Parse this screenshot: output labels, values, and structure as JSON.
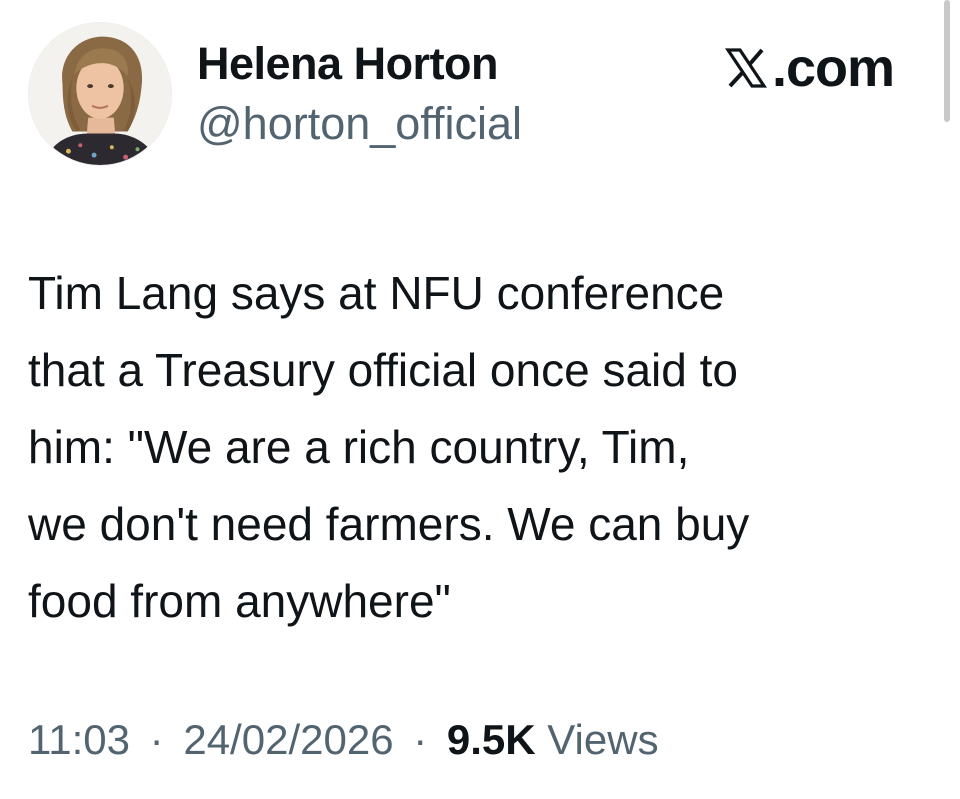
{
  "author": {
    "display_name": "Helena Horton",
    "handle": "@horton_official",
    "avatar_icon": "profile-photo"
  },
  "brand": {
    "icon": "x-logo-icon",
    "label": "𝕏.com",
    "text": ".com"
  },
  "tweet": {
    "text": "Tim Lang says at NFU conference\nthat a Treasury official once said to\nhim: \"We are a rich country, Tim,\nwe don't need farmers. We can buy\nfood from anywhere\""
  },
  "meta": {
    "time": "11:03",
    "separator": "·",
    "date": "24/02/2026",
    "views_count": "9.5K",
    "views_label": "Views"
  },
  "colors": {
    "primary_text": "#0f1419",
    "secondary_text": "#536471",
    "background": "#ffffff"
  }
}
